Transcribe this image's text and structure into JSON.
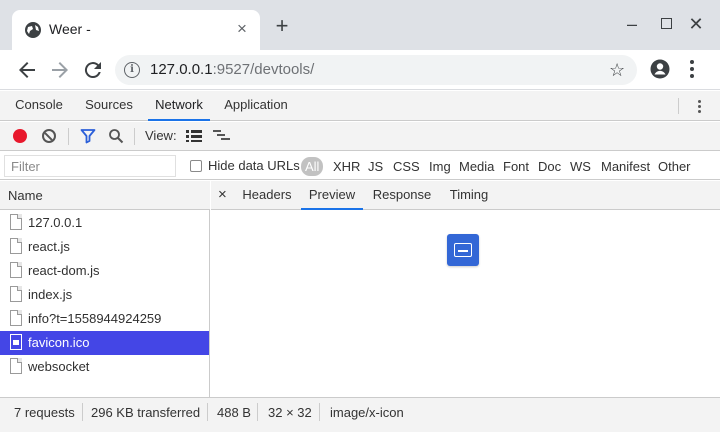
{
  "browser": {
    "tab_title": "Weer -",
    "tab_close": "×",
    "new_tab": "+",
    "url_host": "127.0.0.1",
    "url_rest": ":9527/devtools/",
    "window_controls": {
      "minimize": "–",
      "close": "✕"
    }
  },
  "icons": [
    "globe-icon",
    "back-arrow-icon",
    "forward-arrow-icon",
    "reload-icon",
    "info-icon",
    "star-icon",
    "profile-icon",
    "more-icon",
    "record-icon",
    "clear-icon",
    "filter-icon",
    "search-icon",
    "large-rows-icon",
    "waterfall-icon",
    "document-icon",
    "image-icon"
  ],
  "devtools": {
    "tabs": [
      "Console",
      "Sources",
      "Network",
      "Application"
    ],
    "active_tab": "Network",
    "toolbar": {
      "view_label": "View:"
    },
    "filter": {
      "placeholder": "Filter",
      "hide_data_urls": "Hide data URLs",
      "types": [
        "All",
        "XHR",
        "JS",
        "CSS",
        "Img",
        "Media",
        "Font",
        "Doc",
        "WS",
        "Manifest",
        "Other"
      ],
      "active_type": "All"
    },
    "requests": {
      "header": "Name",
      "items": [
        "127.0.0.1",
        "react.js",
        "react-dom.js",
        "index.js",
        "info?t=1558944924259",
        "favicon.ico",
        "websocket"
      ],
      "selected": "favicon.ico"
    },
    "detail": {
      "close": "×",
      "tabs": [
        "Headers",
        "Preview",
        "Response",
        "Timing"
      ],
      "active_tab": "Preview"
    },
    "status": {
      "requests": "7 requests",
      "transferred": "296 KB transferred",
      "size": "488 B",
      "dimensions": "32 × 32",
      "mime": "image/x-icon"
    }
  },
  "colors": {
    "accent": "#1a73e8",
    "selected_row": "#4446e6",
    "record": "#e8182c",
    "preview_icon": "#3367d6"
  }
}
